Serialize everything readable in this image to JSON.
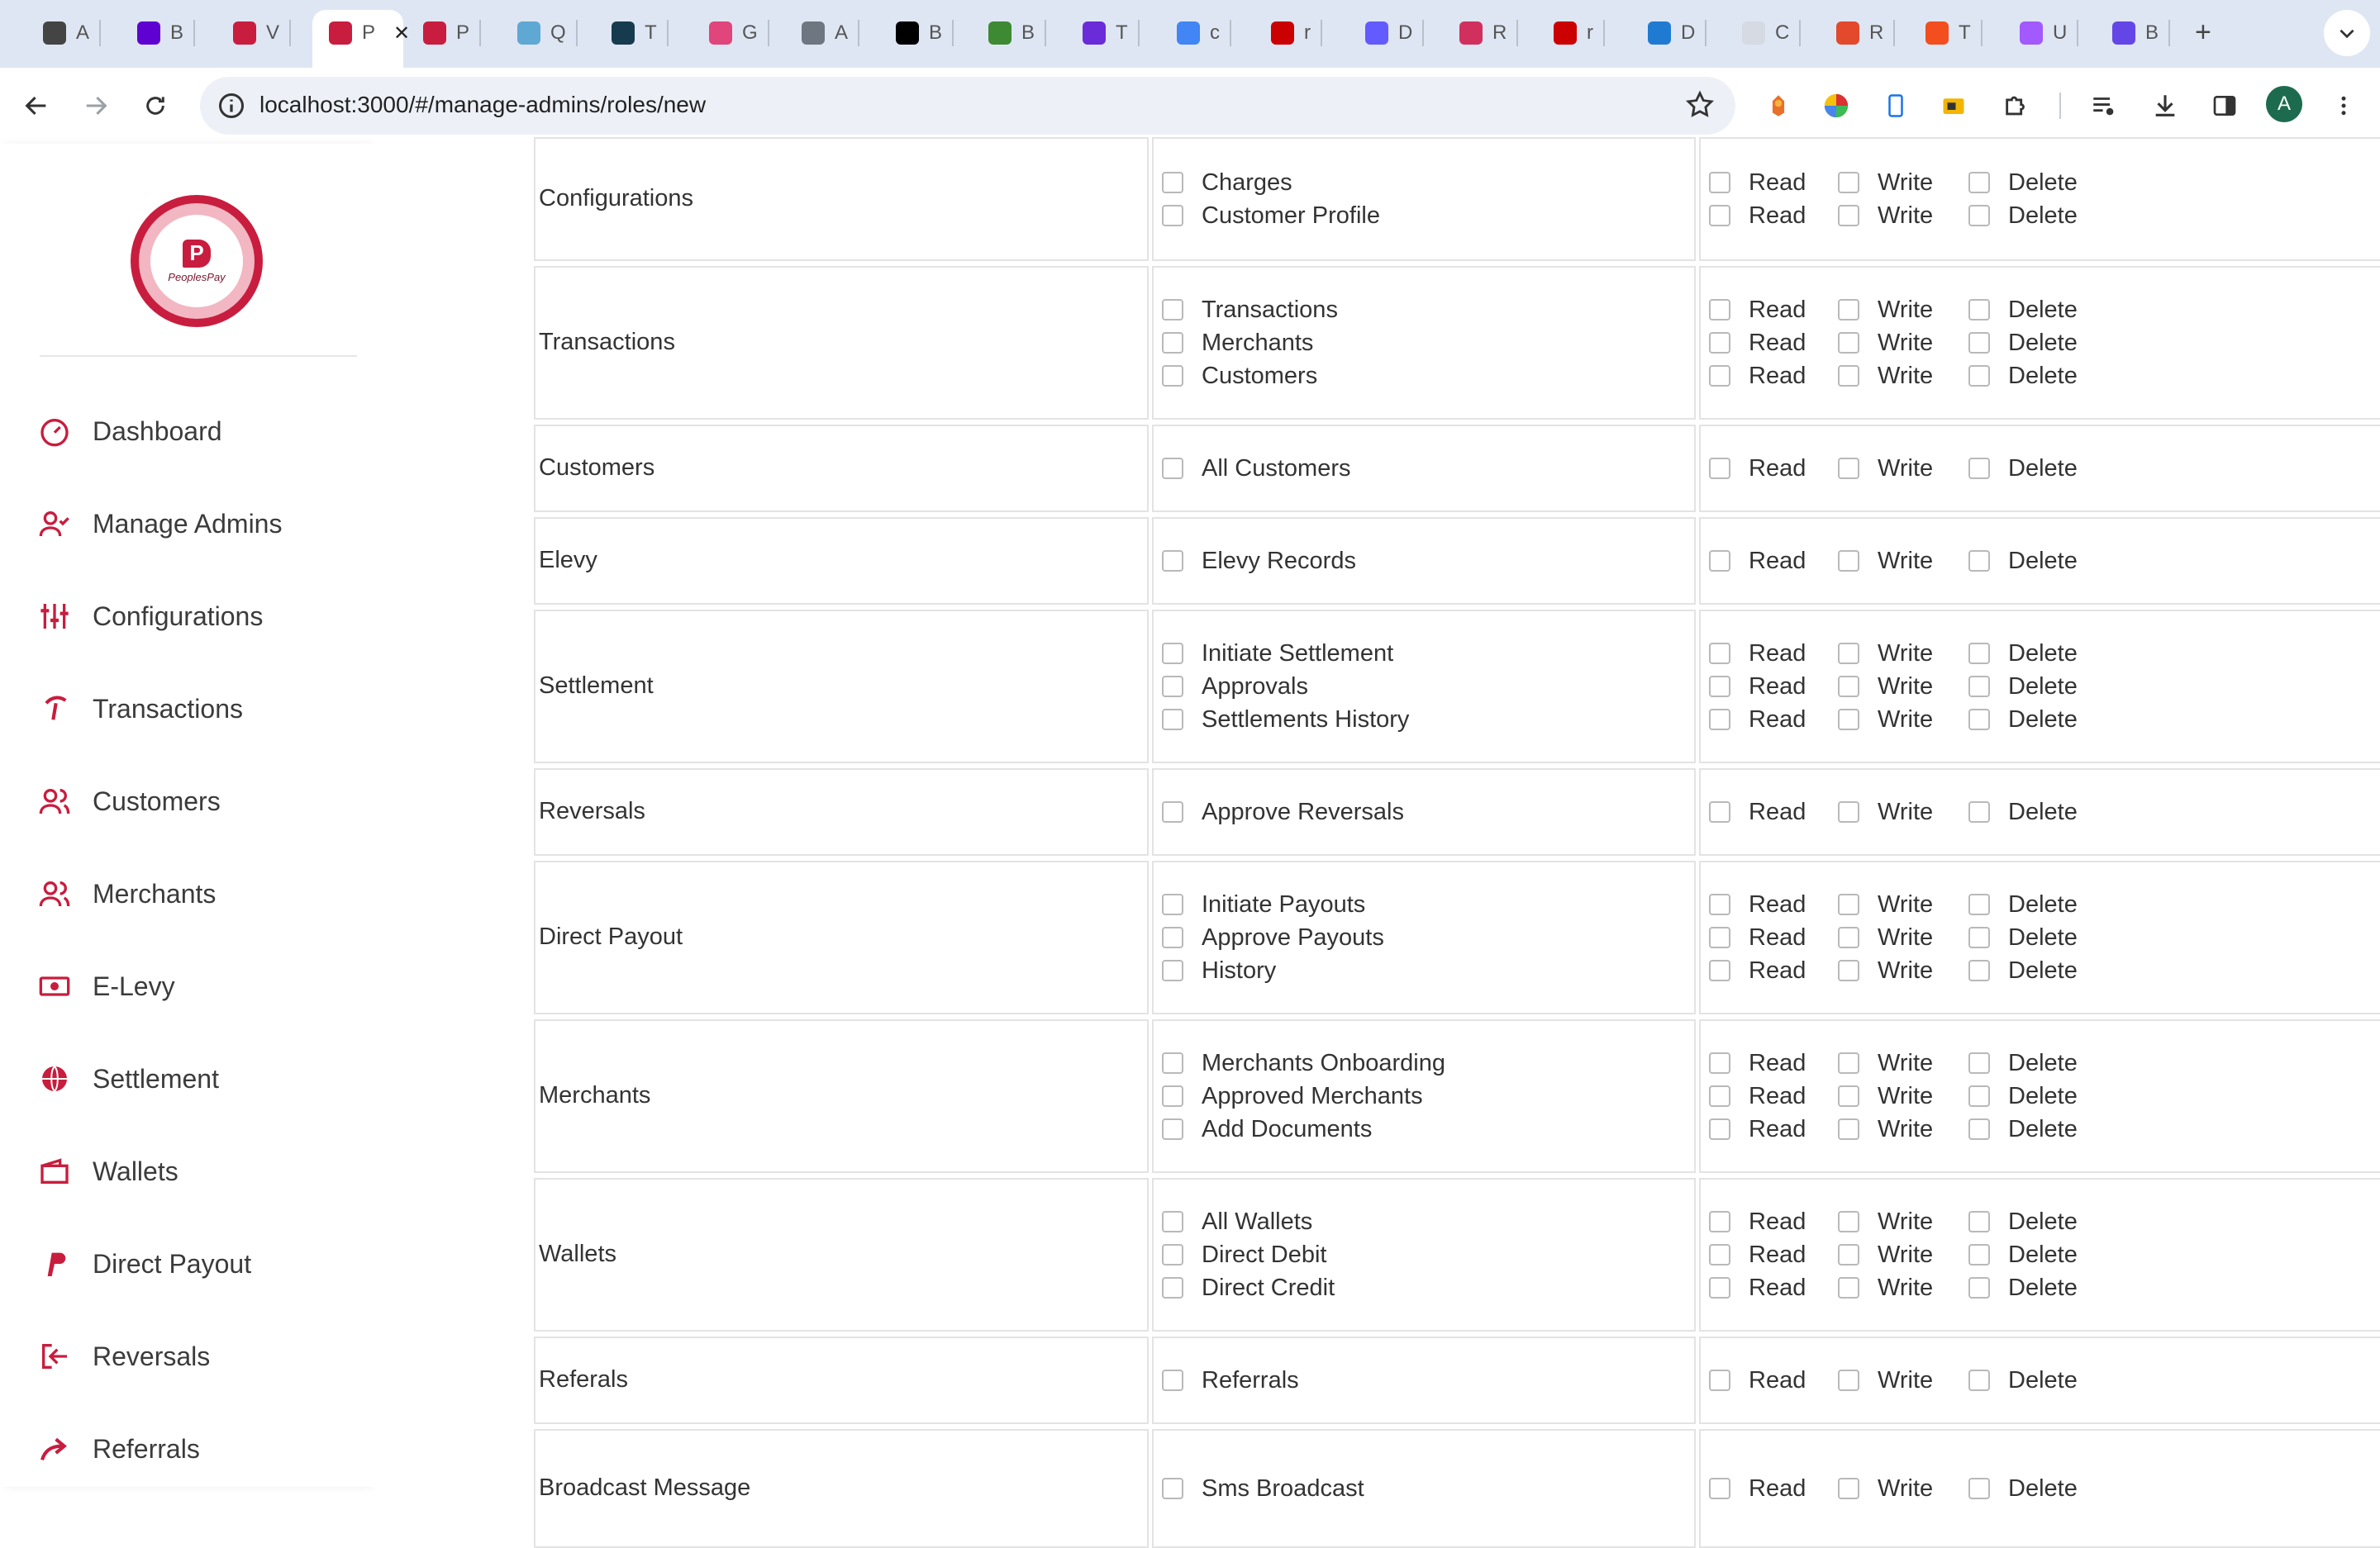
{
  "browser": {
    "tabs": [
      {
        "icon": "openai-favicon",
        "title": "A",
        "color": "#444444"
      },
      {
        "icon": "yahoo-favicon",
        "title": "B",
        "color": "#5f01d1"
      },
      {
        "icon": "peoplespay-favicon",
        "title": "V",
        "color": "#c81d3e"
      },
      {
        "icon": "peoplespay-favicon",
        "title": "P",
        "color": "#c81d3e",
        "active": true
      },
      {
        "icon": "peoplespay-favicon",
        "title": "P",
        "color": "#c81d3e"
      },
      {
        "icon": "react-favicon",
        "title": "Q",
        "color": "#5fa8d3"
      },
      {
        "icon": "xe-favicon",
        "title": "T",
        "color": "#163b4e"
      },
      {
        "icon": "app-favicon",
        "title": "G",
        "color": "#e0457b"
      },
      {
        "icon": "github-favicon",
        "title": "A",
        "color": "#6e7781"
      },
      {
        "icon": "nextjs-favicon",
        "title": "B",
        "color": "#000000"
      },
      {
        "icon": "green-square-favicon",
        "title": "B",
        "color": "#3d8a32"
      },
      {
        "icon": "b-favicon",
        "title": "T",
        "color": "#6a2bd9"
      },
      {
        "icon": "google-favicon",
        "title": "c",
        "color": "#4285f4"
      },
      {
        "icon": "npm-favicon",
        "title": "r",
        "color": "#cb0000"
      },
      {
        "icon": "stripe-favicon",
        "title": "D",
        "color": "#635bff"
      },
      {
        "icon": "react-favicon",
        "title": "R",
        "color": "#d1305e"
      },
      {
        "icon": "npm-favicon",
        "title": "r",
        "color": "#cb0000"
      },
      {
        "icon": "vscode-favicon",
        "title": "D",
        "color": "#1f7bd2"
      },
      {
        "icon": "blank-favicon",
        "title": "C",
        "color": "#d6dae2"
      },
      {
        "icon": "chart-favicon",
        "title": "R",
        "color": "#e24a2b"
      },
      {
        "icon": "figma-favicon",
        "title": "T",
        "color": "#f24e1e"
      },
      {
        "icon": "figma-favicon",
        "title": "U",
        "color": "#a259ff"
      },
      {
        "icon": "hex-favicon",
        "title": "B",
        "color": "#6446e6"
      }
    ],
    "new_tab": "+",
    "url": "localhost:3000/#/manage-admins/roles/new",
    "profile_initial": "A"
  },
  "brand": {
    "name": "PeoplesPay",
    "primary": "#c81d3e"
  },
  "sidebar": {
    "items": [
      {
        "label": "Dashboard",
        "icon": "dashboard-gauge-icon"
      },
      {
        "label": "Manage Admins",
        "icon": "user-check-icon"
      },
      {
        "label": "Configurations",
        "icon": "sliders-icon"
      },
      {
        "label": "Transactions",
        "icon": "transactions-icon"
      },
      {
        "label": "Customers",
        "icon": "users-icon"
      },
      {
        "label": "Merchants",
        "icon": "users-icon"
      },
      {
        "label": "E-Levy",
        "icon": "cash-note-icon"
      },
      {
        "label": "Settlement",
        "icon": "globe-icon"
      },
      {
        "label": "Wallets",
        "icon": "wallet-icon"
      },
      {
        "label": "Direct Payout",
        "icon": "paypal-icon"
      },
      {
        "label": "Reversals",
        "icon": "logout-arrow-icon"
      },
      {
        "label": "Referrals",
        "icon": "share-arrow-icon"
      }
    ]
  },
  "permissions": {
    "options": [
      "Read",
      "Write",
      "Delete"
    ],
    "rows": [
      {
        "module": "Configurations",
        "items": [
          "Charges",
          "Customer Profile"
        ]
      },
      {
        "module": "Transactions",
        "items": [
          "Transactions",
          "Merchants",
          "Customers"
        ]
      },
      {
        "module": "Customers",
        "items": [
          "All Customers"
        ]
      },
      {
        "module": "Elevy",
        "items": [
          "Elevy Records"
        ]
      },
      {
        "module": "Settlement",
        "items": [
          "Initiate Settlement",
          "Approvals",
          "Settlements History"
        ]
      },
      {
        "module": "Reversals",
        "items": [
          "Approve Reversals"
        ]
      },
      {
        "module": "Direct Payout",
        "items": [
          "Initiate Payouts",
          "Approve Payouts",
          "History"
        ]
      },
      {
        "module": "Merchants",
        "items": [
          "Merchants Onboarding",
          "Approved Merchants",
          "Add Documents"
        ]
      },
      {
        "module": "Wallets",
        "items": [
          "All Wallets",
          "Direct Debit",
          "Direct Credit"
        ]
      },
      {
        "module": "Referals",
        "items": [
          "Referrals"
        ]
      },
      {
        "module": "Broadcast Message",
        "items": [
          "Sms Broadcast"
        ]
      }
    ]
  }
}
